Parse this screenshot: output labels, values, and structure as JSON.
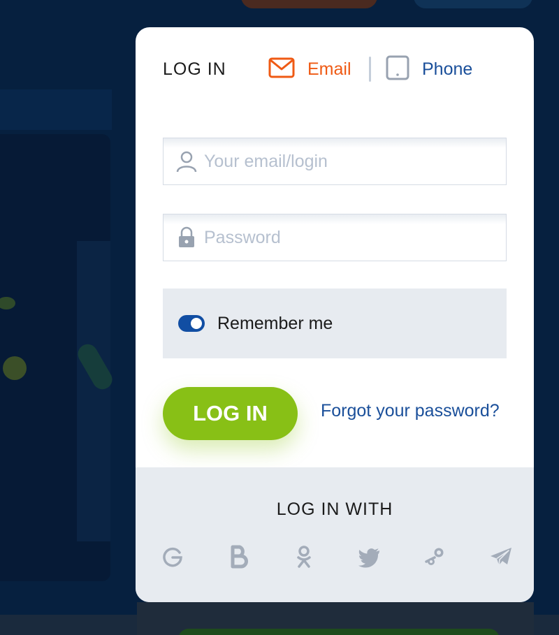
{
  "modal": {
    "title": "LOG IN",
    "tabs": [
      {
        "label": "Email",
        "icon": "envelope-icon",
        "active": true,
        "color": "#ef5a14"
      },
      {
        "label": "Phone",
        "icon": "phone-icon",
        "active": false,
        "color": "#1a4f9a"
      }
    ],
    "fields": {
      "email": {
        "placeholder": "Your email/login",
        "value": "",
        "icon": "user-icon"
      },
      "password": {
        "placeholder": "Password",
        "value": "",
        "icon": "lock-icon"
      }
    },
    "remember": {
      "label": "Remember me",
      "checked": true
    },
    "login_button": "LOG IN",
    "forgot_link": "Forgot your password?",
    "social": {
      "title": "LOG IN WITH",
      "providers": [
        "google-icon",
        "bold-b-icon",
        "odnoklassniki-icon",
        "twitter-icon",
        "steam-icon",
        "telegram-icon"
      ]
    }
  },
  "colors": {
    "accent_orange": "#ef5a14",
    "link_blue": "#1a4f9a",
    "button_green": "#88c016",
    "toggle_blue": "#114ea3",
    "social_gray": "#a3acb9"
  }
}
